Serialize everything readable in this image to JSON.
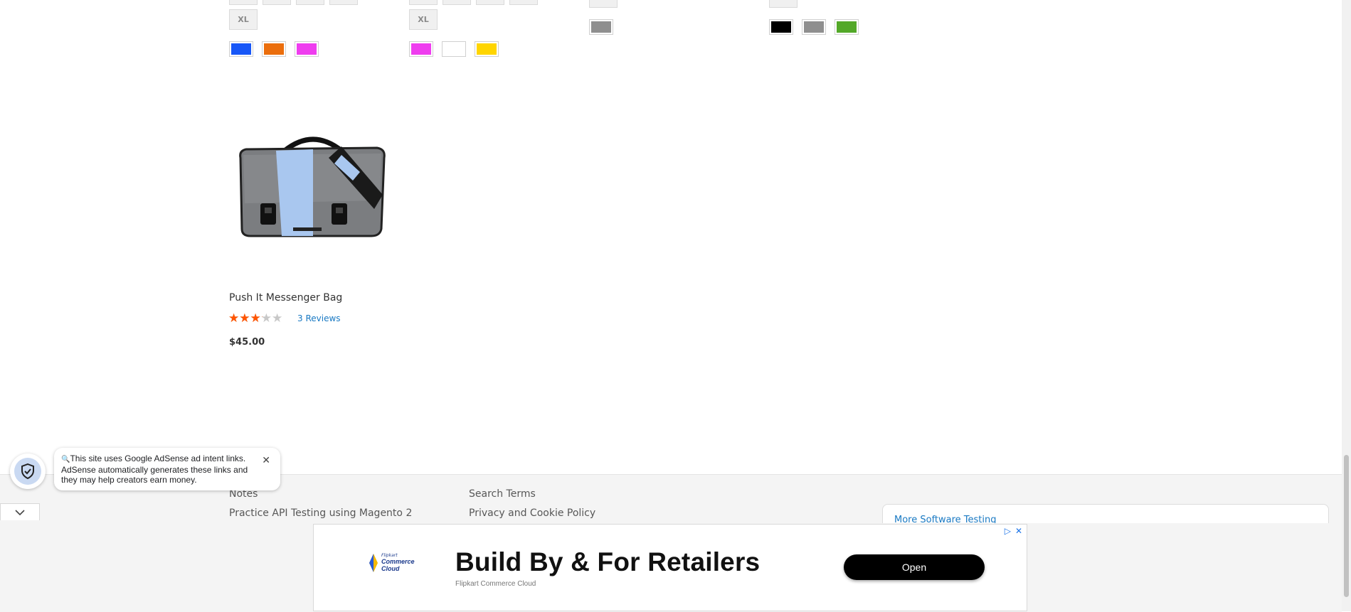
{
  "product_grid": {
    "row1": [
      {
        "size_labels": [
          "XL"
        ],
        "colors": [
          "#1857f7",
          "#eb6e0d",
          "#ef3def"
        ]
      },
      {
        "size_labels": [
          "XL"
        ],
        "colors": [
          "#ef3def",
          "#ffffff",
          "#ffd500"
        ]
      },
      {
        "size_labels": [],
        "colors": [
          "#8f8f8f"
        ]
      },
      {
        "size_labels": [],
        "colors": [
          "#000000",
          "#8f8f8f",
          "#53a828"
        ]
      }
    ],
    "product": {
      "name": "Push It Messenger Bag",
      "rating_percent": 63,
      "reviews": "3 Reviews",
      "price": "$45.00"
    }
  },
  "footer": {
    "col1": [
      "Notes",
      "Practice API Testing using Magento 2"
    ],
    "col2": [
      "Search Terms",
      "Privacy and Cookie Policy"
    ],
    "widget_text": "More   Software Testing"
  },
  "adsense_notice": {
    "text": "This site uses Google AdSense ad intent links. AdSense automatically generates these links and they may help creators earn money."
  },
  "ad": {
    "headline": "Build By & For Retailers",
    "sponsor": "Flipkart Commerce Cloud",
    "cta": "Open",
    "logo_lines": [
      "Commerce",
      "Cloud"
    ],
    "logo_small": "Flipkart"
  }
}
